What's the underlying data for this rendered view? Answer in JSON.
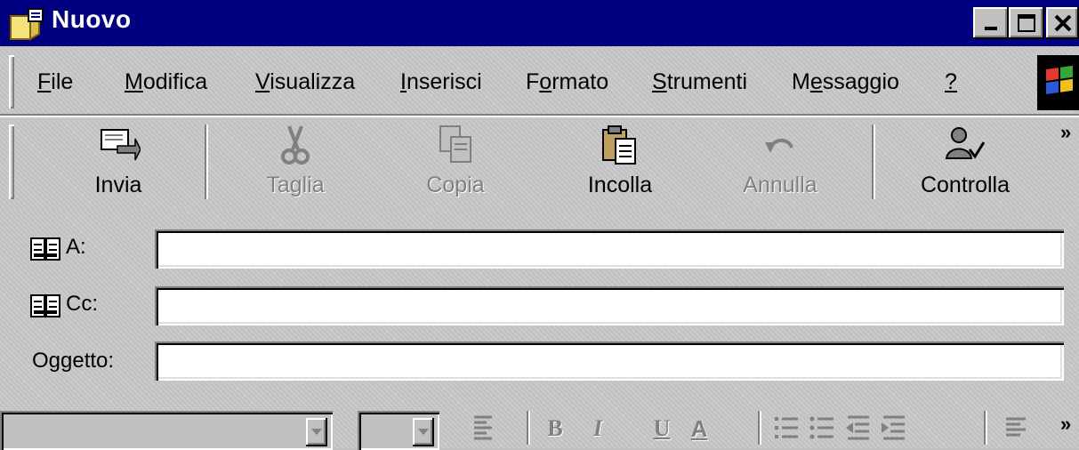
{
  "window": {
    "title": "Nuovo",
    "controls": [
      "minimize",
      "maximize",
      "close"
    ]
  },
  "menubar": {
    "items": [
      {
        "label": "File",
        "accel": "F",
        "rest": "ile"
      },
      {
        "label": "Modifica",
        "accel": "M",
        "rest": "odifica"
      },
      {
        "label": "Visualizza",
        "accel": "V",
        "rest": "isualizza"
      },
      {
        "label": "Inserisci",
        "accel": "I",
        "rest": "nserisci"
      },
      {
        "label": "Formato",
        "pre": "F",
        "accel": "o",
        "rest": "rmato"
      },
      {
        "label": "Strumenti",
        "accel": "S",
        "rest": "trumenti"
      },
      {
        "label": "Messaggio",
        "pre": "M",
        "accel": "e",
        "rest": "ssaggio"
      },
      {
        "label": "?",
        "accel": "?",
        "rest": ""
      }
    ]
  },
  "toolbar": {
    "send": {
      "label": "Invia",
      "enabled": true
    },
    "cut": {
      "label": "Taglia",
      "enabled": false
    },
    "copy": {
      "label": "Copia",
      "enabled": false
    },
    "paste": {
      "label": "Incolla",
      "enabled": true
    },
    "undo": {
      "label": "Annulla",
      "enabled": false
    },
    "check": {
      "label": "Controlla",
      "enabled": true
    },
    "more": "»"
  },
  "fields": {
    "to": {
      "label": "A:",
      "value": ""
    },
    "cc": {
      "label": "Cc:",
      "value": ""
    },
    "subject": {
      "label": "Oggetto:",
      "value": ""
    }
  },
  "format_toolbar": {
    "font_name": "",
    "font_size": "",
    "bold": "B",
    "italic": "I",
    "underline": "U",
    "font_color": "A",
    "more": "»"
  },
  "colors": {
    "titlebar": "#000080",
    "face": "#c0c0c0",
    "disabled_text": "#808080"
  }
}
